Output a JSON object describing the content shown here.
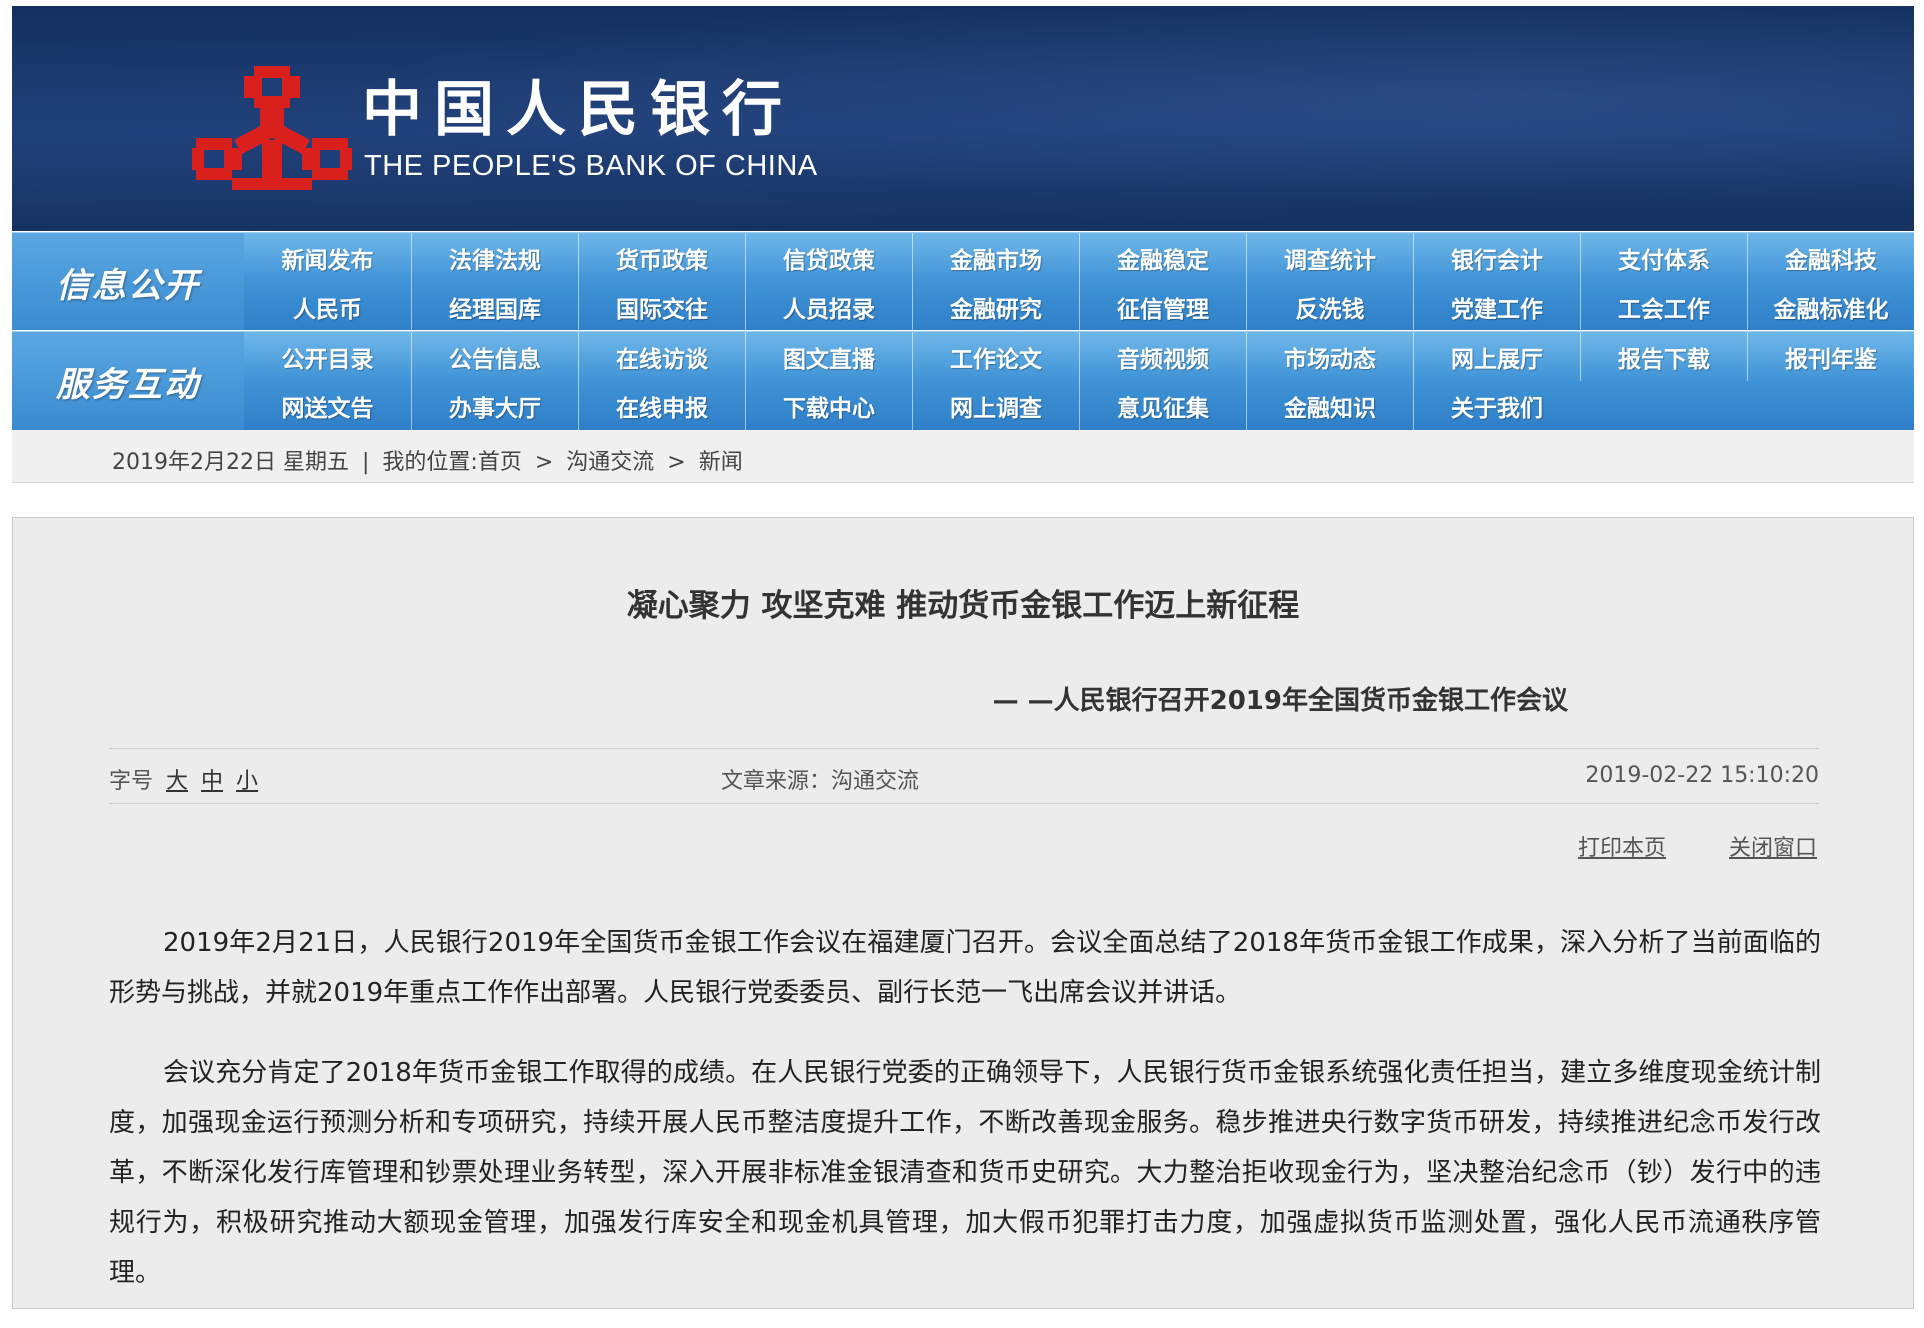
{
  "header": {
    "cn_name": "中国人民银行",
    "en_name": "THE PEOPLE'S BANK OF CHINA",
    "brand_red": "#d9201d",
    "banner_blue": "#1d3e76"
  },
  "nav": {
    "info": {
      "label": "信息公开",
      "row1": [
        "新闻发布",
        "法律法规",
        "货币政策",
        "信贷政策",
        "金融市场",
        "金融稳定",
        "调查统计",
        "银行会计",
        "支付体系",
        "金融科技"
      ],
      "row2": [
        "人民币",
        "经理国库",
        "国际交往",
        "人员招录",
        "金融研究",
        "征信管理",
        "反洗钱",
        "党建工作",
        "工会工作",
        "金融标准化"
      ]
    },
    "service": {
      "label": "服务互动",
      "row1": [
        "公开目录",
        "公告信息",
        "在线访谈",
        "图文直播",
        "工作论文",
        "音频视频",
        "市场动态",
        "网上展厅",
        "报告下载",
        "报刊年鉴"
      ],
      "row2": [
        "网送文告",
        "办事大厅",
        "在线申报",
        "下载中心",
        "网上调查",
        "意见征集",
        "金融知识",
        "关于我们"
      ]
    }
  },
  "breadcrumb": {
    "date": "2019年2月22日 星期五",
    "divider": "|",
    "location_label": "我的位置:",
    "home": "首页",
    "arrow": ">",
    "section": "沟通交流",
    "page": "新闻"
  },
  "article": {
    "title": "凝心聚力 攻坚克难 推动货币金银工作迈上新征程",
    "subtitle": "— —人民银行召开2019年全国货币金银工作会议",
    "font_size_label": "字号",
    "font_sizes": [
      "大",
      "中",
      "小"
    ],
    "source": "文章来源：沟通交流",
    "datetime": "2019-02-22 15:10:20",
    "print_label": "打印本页",
    "close_label": "关闭窗口",
    "paragraphs": [
      "2019年2月21日，人民银行2019年全国货币金银工作会议在福建厦门召开。会议全面总结了2018年货币金银工作成果，深入分析了当前面临的形势与挑战，并就2019年重点工作作出部署。人民银行党委委员、副行长范一飞出席会议并讲话。",
      "会议充分肯定了2018年货币金银工作取得的成绩。在人民银行党委的正确领导下，人民银行货币金银系统强化责任担当，建立多维度现金统计制度，加强现金运行预测分析和专项研究，持续开展人民币整洁度提升工作，不断改善现金服务。稳步推进央行数字货币研发，持续推进纪念币发行改革，不断深化发行库管理和钞票处理业务转型，深入开展非标准金银清查和货币史研究。大力整治拒收现金行为，坚决整治纪念币（钞）发行中的违规行为，积极研究推动大额现金管理，加强发行库安全和现金机具管理，加大假币犯罪打击力度，加强虚拟货币监测处置，强化人民币流通秩序管理。"
    ]
  }
}
